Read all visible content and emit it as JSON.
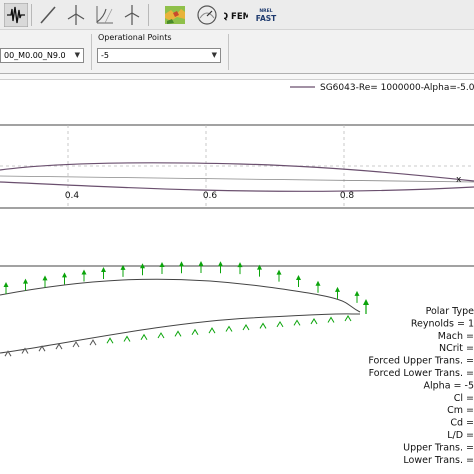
{
  "toolbar": {
    "items": [
      {
        "icon": "oscilloscope-icon",
        "active": true
      },
      {
        "icon": "slash-line-icon"
      },
      {
        "icon": "wind-turbine-icon"
      },
      {
        "icon": "cp-curve-icon"
      },
      {
        "icon": "wind-turbine-icon"
      },
      {
        "icon": "terrain-map-icon"
      },
      {
        "icon": "dashboard-icon"
      },
      {
        "icon": "qfem-icon",
        "label": "Q FEM"
      },
      {
        "icon": "noise-fast-icon",
        "label_top": "NREL",
        "label_bottom": "FAST"
      }
    ]
  },
  "selectors": {
    "polar_value": "00_M0.00_N9.0",
    "op_points_label": "Operational Points",
    "op_point_value": "-5"
  },
  "plot": {
    "legend_label": "SG6043-Re= 1000000-Alpha=-5.00",
    "x_ticks": [
      "0.4",
      "0.6",
      "0.8"
    ],
    "transition_marker": "x",
    "series_color": "#6a4f6e",
    "arrow_color": "#0ba40b"
  },
  "polar_info": [
    "Polar Type",
    "Reynolds = 1",
    "Mach =",
    "NCrit =",
    "Forced Upper Trans. =",
    "Forced Lower Trans. =",
    "Alpha =  -5",
    "Cl =",
    "Cm =",
    "Cd =",
    "L/D =",
    "Upper Trans. =",
    "Lower Trans. ="
  ]
}
